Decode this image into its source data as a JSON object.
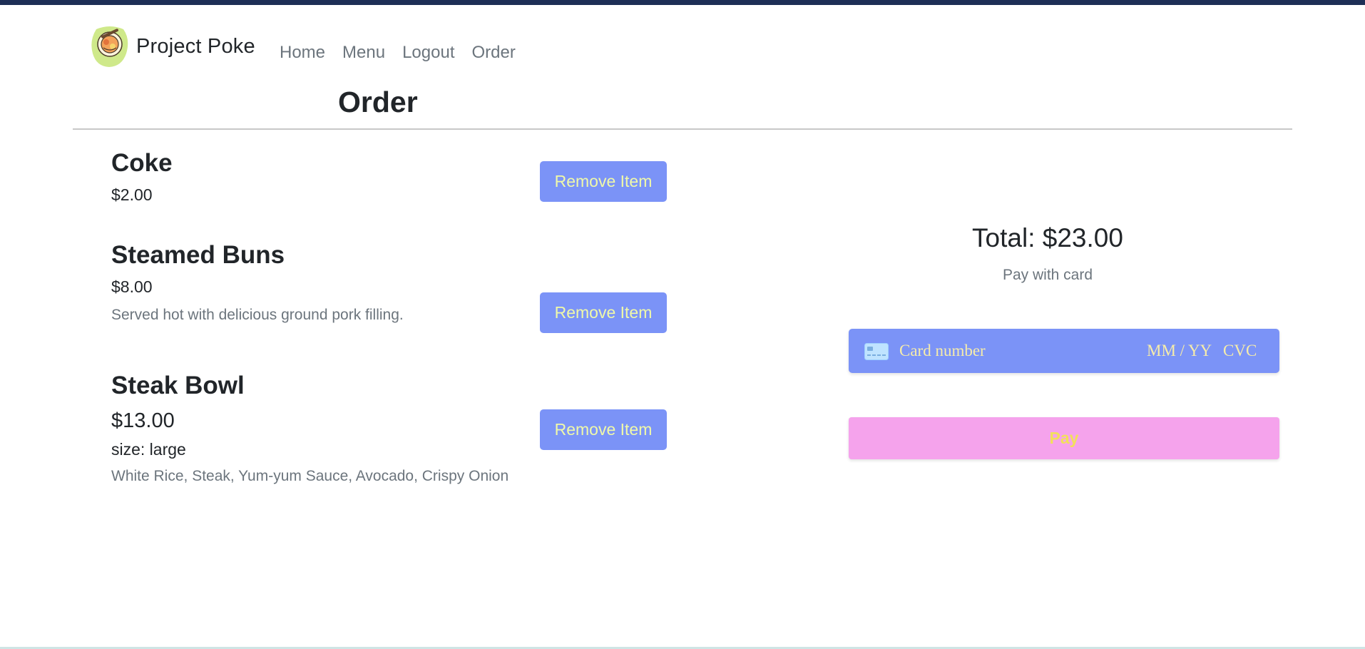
{
  "app": {
    "brand_name": "Project Poke",
    "logo_icon": "poke-bowl-logo-icon"
  },
  "nav": {
    "items": [
      {
        "label": "Home"
      },
      {
        "label": "Menu"
      },
      {
        "label": "Logout"
      },
      {
        "label": "Order"
      }
    ]
  },
  "page": {
    "title": "Order"
  },
  "order": {
    "items": [
      {
        "name": "Coke",
        "price": "$2.00",
        "remove_label": "Remove Item"
      },
      {
        "name": "Steamed Buns",
        "price": "$8.00",
        "description": "Served hot with delicious ground pork filling.",
        "remove_label": "Remove Item"
      },
      {
        "name": "Steak Bowl",
        "price": "$13.00",
        "size": "size: large",
        "description": "White Rice, Steak, Yum-yum Sauce, Avocado, Crispy Onion",
        "remove_label": "Remove Item"
      }
    ]
  },
  "payment": {
    "total": "Total: $23.00",
    "pay_with": "Pay with card",
    "card_icon": "credit-card-icon",
    "card_number_placeholder": "Card number",
    "expiry_placeholder": "MM / YY",
    "cvc_placeholder": "CVC",
    "pay_label": "Pay"
  },
  "colors": {
    "topbar": "#1e2f56",
    "button_bg": "#7b93f7",
    "button_text": "#f0f9a8",
    "pay_bg": "#f5a3ec",
    "pay_text": "#f2e05b"
  }
}
